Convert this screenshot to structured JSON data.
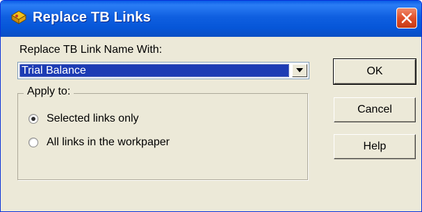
{
  "dialog": {
    "title": "Replace TB Links",
    "close_icon": "close-icon",
    "app_icon": "workpaper-app-icon"
  },
  "form": {
    "name_label": "Replace TB Link Name With:",
    "name_value": "Trial Balance",
    "dropdown_icon": "chevron-down-icon"
  },
  "apply": {
    "group_label": "Apply to:",
    "options": [
      {
        "label": "Selected links only",
        "selected": true
      },
      {
        "label": "All links in the workpaper",
        "selected": false
      }
    ]
  },
  "buttons": {
    "ok": "OK",
    "cancel": "Cancel",
    "help": "Help"
  },
  "colors": {
    "titlebar": "#0656d8",
    "selection": "#1c3bb4",
    "dialog_bg": "#ece9d8",
    "close_button": "#e0502a"
  }
}
